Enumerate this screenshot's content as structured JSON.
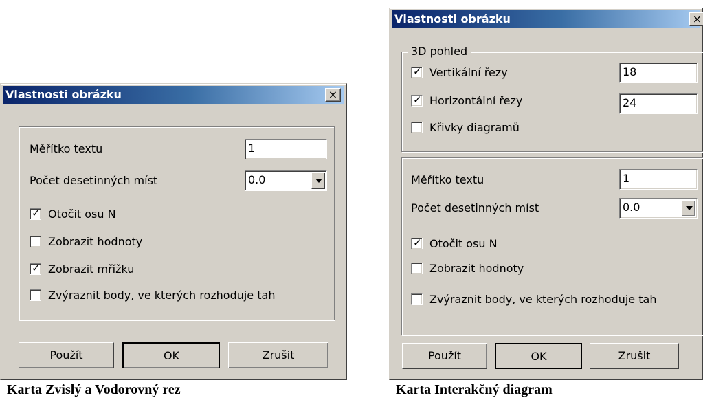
{
  "dialog_left": {
    "title": "Vlastnosti obrázku",
    "close": "×",
    "text_scale_label": "Měřítko textu",
    "text_scale_value": "1",
    "decimals_label": "Počet desetinných míst",
    "decimals_value": "0.0",
    "checkboxes": [
      {
        "label": "Otočit osu N",
        "checked": true,
        "mark": "✓"
      },
      {
        "label": "Zobrazit hodnoty",
        "checked": false,
        "mark": ""
      },
      {
        "label": "Zobrazit mřížku",
        "checked": true,
        "mark": "✓"
      },
      {
        "label": "Zvýraznit body, ve kterých rozhoduje tah",
        "checked": false,
        "mark": ""
      }
    ],
    "buttons": {
      "apply": "Použít",
      "ok": "OK",
      "cancel": "Zrušit"
    }
  },
  "dialog_right": {
    "title": "Vlastnosti obrázku",
    "close": "×",
    "group_title": "3D pohled",
    "view_checkboxes": [
      {
        "label": "Vertikální řezy",
        "checked": true,
        "mark": "✓"
      },
      {
        "label": "Horizontální řezy",
        "checked": true,
        "mark": "✓"
      },
      {
        "label": "Křivky diagramů",
        "checked": false,
        "mark": ""
      }
    ],
    "vertical_value": "18",
    "horizontal_value": "24",
    "text_scale_label": "Měřítko textu",
    "text_scale_value": "1",
    "decimals_label": "Počet desetinných míst",
    "decimals_value": "0.0",
    "checkboxes": [
      {
        "label": "Otočit osu N",
        "checked": true,
        "mark": "✓"
      },
      {
        "label": "Zobrazit hodnoty",
        "checked": false,
        "mark": ""
      },
      {
        "label": "Zvýraznit body, ve kterých rozhoduje tah",
        "checked": false,
        "mark": ""
      }
    ],
    "buttons": {
      "apply": "Použít",
      "ok": "OK",
      "cancel": "Zrušit"
    }
  },
  "captions": {
    "left": "Karta Zvislý a Vodorovný rez",
    "right": "Karta Interakčný diagram"
  }
}
